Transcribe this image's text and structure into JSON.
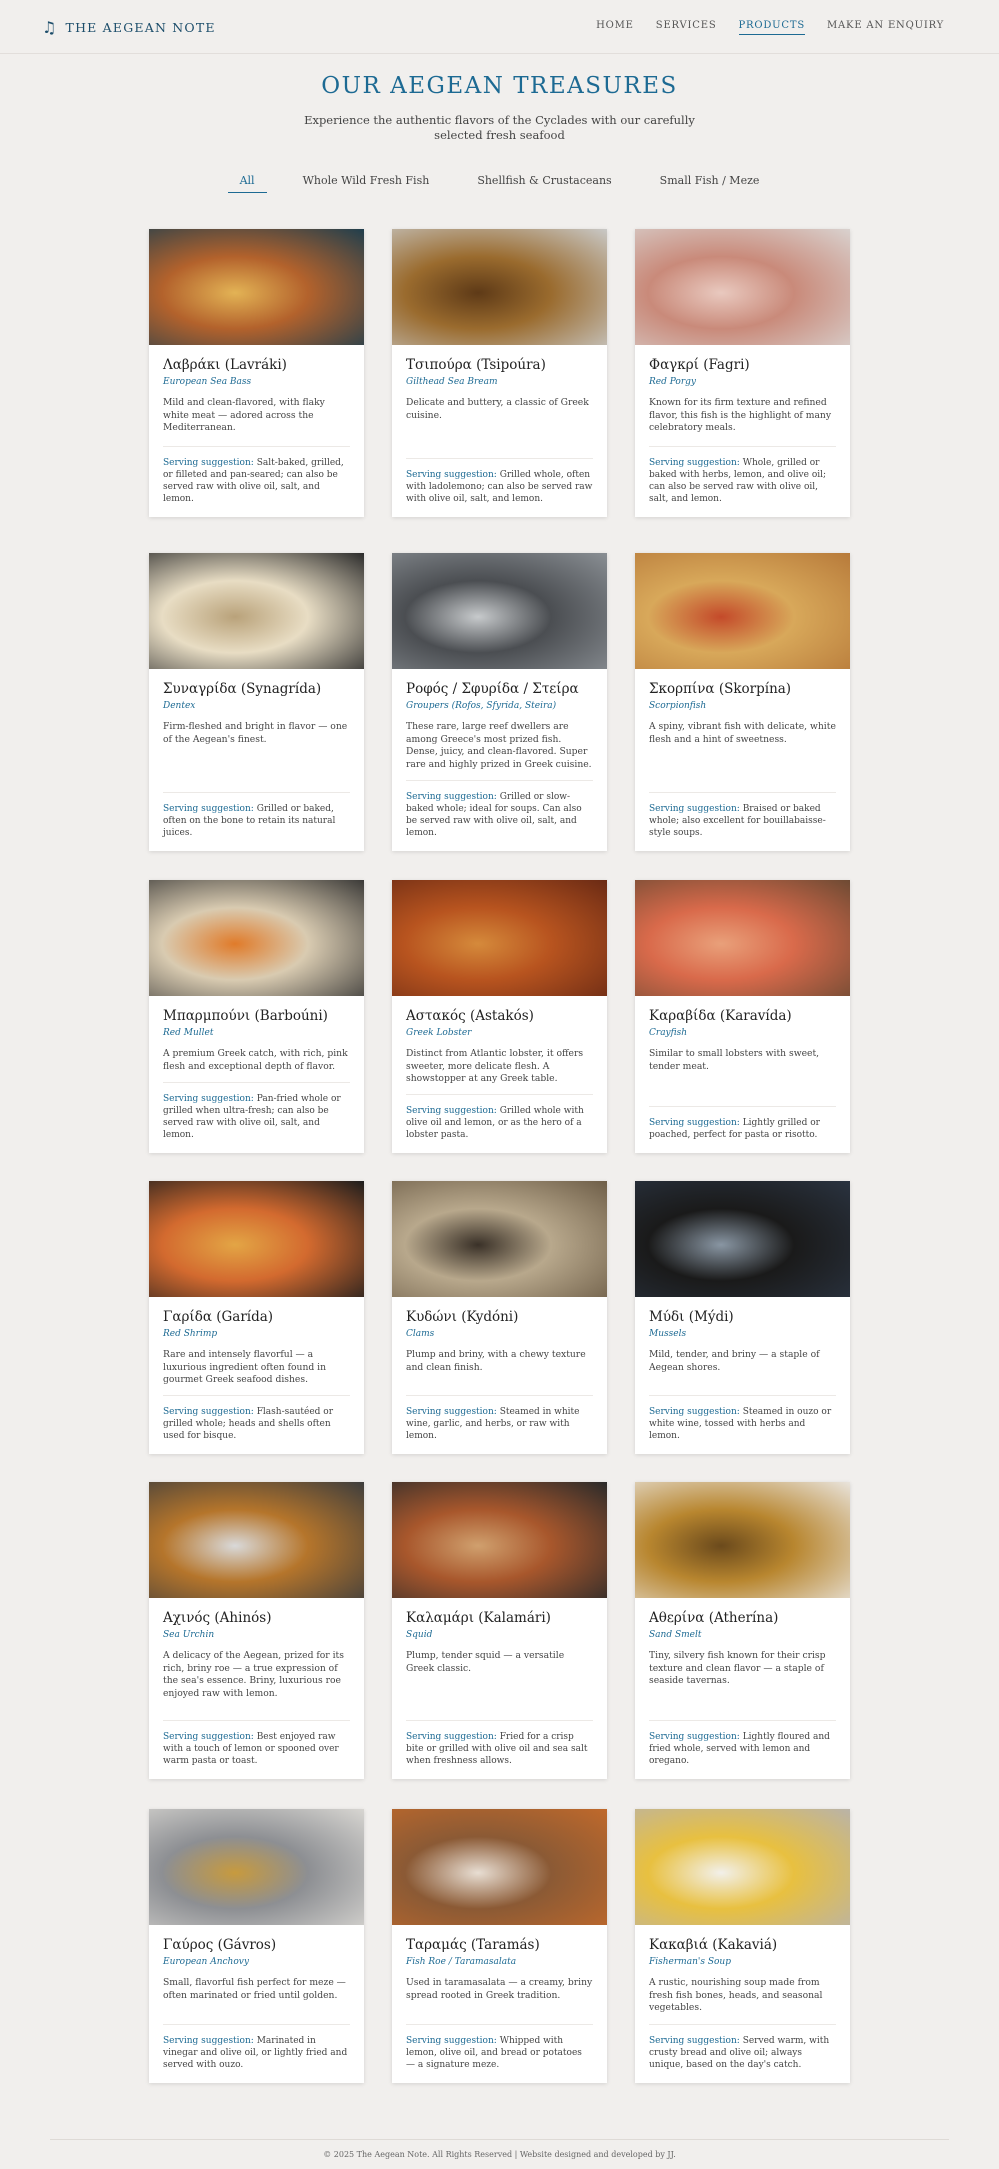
{
  "brand": {
    "icon": "music-note-icon",
    "name": "THE AEGEAN NOTE"
  },
  "nav": [
    {
      "label": "HOME",
      "active": false
    },
    {
      "label": "SERVICES",
      "active": false
    },
    {
      "label": "PRODUCTS",
      "active": true
    },
    {
      "label": "MAKE AN ENQUIRY",
      "active": false
    }
  ],
  "hero": {
    "title": "OUR AEGEAN TREASURES",
    "subtitle": "Experience the authentic flavors of the Cyclades with our carefully selected fresh seafood"
  },
  "filters": [
    {
      "label": "All",
      "active": true
    },
    {
      "label": "Whole Wild Fresh Fish",
      "active": false
    },
    {
      "label": "Shellfish & Crustaceans",
      "active": false
    },
    {
      "label": "Small Fish / Meze",
      "active": false
    }
  ],
  "serving_label": "Serving suggestion:",
  "products": [
    {
      "title": "Λαβράκι (Lavráki)",
      "en": "European Sea Bass",
      "desc": "Mild and clean-flavored, with flaky white meat — adored across the Mediterranean.",
      "serve": "Salt-baked, grilled, or filleted and pan-seared; can also be served raw with olive oil, salt, and lemon.",
      "img": "grilled sea bass with lemon"
    },
    {
      "title": "Τσιπούρα (Tsipoúra)",
      "en": "Gilthead Sea Bream",
      "desc": "Delicate and buttery, a classic of Greek cuisine.",
      "serve": "Grilled whole, often with ladolemono; can also be served raw with olive oil, salt, and lemon.",
      "img": "whole bream on foil"
    },
    {
      "title": "Φαγκρί (Fagri)",
      "en": "Red Porgy",
      "desc": "Known for its firm texture and refined flavor, this fish is the highlight of many celebratory meals.",
      "serve": "Whole, grilled or baked with herbs, lemon, and olive oil; can also be served raw with olive oil, salt, and lemon.",
      "img": "raw red porgy on ice"
    },
    {
      "title": "Συναγρίδα (Synagrída)",
      "en": "Dentex",
      "desc": "Firm-fleshed and bright in flavor — one of the Aegean's finest.",
      "serve": "Grilled or baked, often on the bone to retain its natural juices.",
      "img": "dentex carpaccio plate"
    },
    {
      "title": "Ροφός / Σφυρίδα / Στείρα",
      "en": "Groupers (Rofos, Sfyrida, Steira)",
      "desc": "These rare, large reef dwellers are among Greece's most prized fish. Dense, juicy, and clean-flavored. Super rare and highly prized in Greek cuisine.",
      "serve": "Grilled or slow-baked whole; ideal for soups. Can also be served raw with olive oil, salt, and lemon.",
      "img": "raw grouper"
    },
    {
      "title": "Σκορπίνα (Skorpína)",
      "en": "Scorpionfish",
      "desc": "A spiny, vibrant fish with delicate, white flesh and a hint of sweetness.",
      "serve": "Braised or baked whole; also excellent for bouillabaisse-style soups.",
      "img": "scorpionfish in broth"
    },
    {
      "title": "Μπαρμπούνι (Barboúni)",
      "en": "Red Mullet",
      "desc": "A premium Greek catch, with rich, pink flesh and exceptional depth of flavor.",
      "serve": "Pan-fried whole or grilled when ultra-fresh; can also be served raw with olive oil, salt, and lemon.",
      "img": "red mullet with green sauce"
    },
    {
      "title": "Αστακός (Astakós)",
      "en": "Greek Lobster",
      "desc": "Distinct from Atlantic lobster, it offers sweeter, more delicate flesh. A showstopper at any Greek table.",
      "serve": "Grilled whole with olive oil and lemon, or as the hero of a lobster pasta.",
      "img": "lobster spaghetti"
    },
    {
      "title": "Καραβίδα (Karavída)",
      "en": "Crayfish",
      "desc": "Similar to small lobsters with sweet, tender meat.",
      "serve": "Lightly grilled or poached, perfect for pasta or risotto.",
      "img": "crayfish in basket"
    },
    {
      "title": "Γαρίδα (Garída)",
      "en": "Red Shrimp",
      "desc": "Rare and intensely flavorful — a luxurious ingredient often found in gourmet Greek seafood dishes.",
      "serve": "Flash-sautéed or grilled whole; heads and shells often used for bisque.",
      "img": "red shrimp appetizers"
    },
    {
      "title": "Κυδώνι (Kydóni)",
      "en": "Clams",
      "desc": "Plump and briny, with a chewy texture and clean finish.",
      "serve": "Steamed in white wine, garlic, and herbs, or raw with lemon.",
      "img": "clams"
    },
    {
      "title": "Μύδι (Mýdi)",
      "en": "Mussels",
      "desc": "Mild, tender, and briny — a staple of Aegean shores.",
      "serve": "Steamed in ouzo or white wine, tossed with herbs and lemon.",
      "img": "mussels bowl"
    },
    {
      "title": "Αχινός (Ahinós)",
      "en": "Sea Urchin",
      "desc": "A delicacy of the Aegean, prized for its rich, briny roe — a true expression of the sea's essence. Briny, luxurious roe enjoyed raw with lemon.",
      "serve": "Best enjoyed raw with a touch of lemon or spooned over warm pasta or toast.",
      "img": "sea urchin roe bowl"
    },
    {
      "title": "Καλαμάρι (Kalamári)",
      "en": "Squid",
      "desc": "Plump, tender squid — a versatile Greek classic.",
      "serve": "Fried for a crisp bite or grilled with olive oil and sea salt when freshness allows.",
      "img": "grilled squid and crab"
    },
    {
      "title": "Αθερίνα (Atherína)",
      "en": "Sand Smelt",
      "desc": "Tiny, silvery fish known for their crisp texture and clean flavor — a staple of seaside tavernas.",
      "serve": "Lightly floured and fried whole, served with lemon and oregano.",
      "img": "fried sand smelt"
    },
    {
      "title": "Γαύρος (Gávros)",
      "en": "European Anchovy",
      "desc": "Small, flavorful fish perfect for meze — often marinated or fried until golden.",
      "serve": "Marinated in vinegar and olive oil, or lightly fried and served with ouzo.",
      "img": "marinated anchovies"
    },
    {
      "title": "Ταραμάς (Taramás)",
      "en": "Fish Roe / Taramasalata",
      "desc": "Used in taramasalata — a creamy, briny spread rooted in Greek tradition.",
      "serve": "Whipped with lemon, olive oil, and bread or potatoes — a signature meze.",
      "img": "taramasalata with bread"
    },
    {
      "title": "Κακαβιά (Kakaviá)",
      "en": "Fisherman's Soup",
      "desc": "A rustic, nourishing soup made from fresh fish bones, heads, and seasonal vegetables.",
      "serve": "Served warm, with crusty bread and olive oil; always unique, based on the day's catch.",
      "img": "fish soup"
    }
  ],
  "footer": "© 2025 The Aegean Note. All Rights Reserved | Website designed and developed by JJ."
}
